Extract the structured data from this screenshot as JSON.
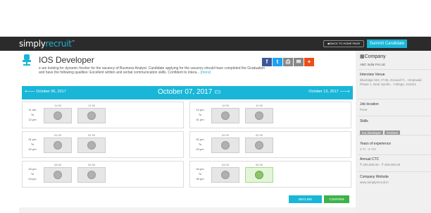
{
  "topbar": {
    "logo_main": "simply",
    "logo_accent": "recruit",
    "logo_tm": "™",
    "back_label": "◀ BACK TO HOME PAGE",
    "user_label": "Summit Candidate"
  },
  "job": {
    "title": "IOS Developer",
    "description": "e are looking for dynamic fresher for the vacancy of Business Analyst. Candidate applying for the vacancy should have completed the Graduation and have the following qualities: Excellent written and verbal communication skills. Confident to intera...",
    "more_label": "[more]",
    "share_icons": [
      "facebook-icon",
      "twitter-icon",
      "print-icon",
      "email-icon",
      "plus-icon"
    ],
    "share_colors": [
      "#3b5998",
      "#1da1f2",
      "#888888",
      "#888888",
      "#e94e1b"
    ]
  },
  "dates": {
    "prev": "October 06, 2017",
    "current": "October 07, 2017",
    "next": "October 13, 2017"
  },
  "schedule": {
    "left": [
      {
        "label": [
          "11 am",
          "To",
          "12 pm"
        ],
        "slots": [
          {
            "time": "11.00",
            "available": false
          },
          {
            "time": "11.30",
            "available": false
          }
        ]
      },
      {
        "label": [
          "01 pm",
          "To",
          "02 pm"
        ],
        "slots": [
          {
            "time": "01.00",
            "available": false
          },
          {
            "time": "01.30",
            "available": false
          }
        ]
      },
      {
        "label": [
          "03 pm",
          "To",
          "04 pm"
        ],
        "slots": [
          {
            "time": "03.00",
            "available": false
          },
          {
            "time": "03.30",
            "available": false
          }
        ]
      }
    ],
    "right": [
      {
        "label": [
          "12 pm",
          "To",
          "01 pm"
        ],
        "slots": [
          {
            "time": "12.00",
            "available": false
          },
          {
            "time": "12.30",
            "available": false
          }
        ]
      },
      {
        "label": [
          "02 pm",
          "To",
          "03 pm"
        ],
        "slots": [
          {
            "time": "02.00",
            "available": false
          },
          {
            "time": "02.30",
            "available": false
          }
        ]
      },
      {
        "label": [
          "04 pm",
          "To",
          "05 pm"
        ],
        "slots": [
          {
            "time": "04.00",
            "available": false
          },
          {
            "time": "04.30",
            "available": true
          }
        ]
      }
    ]
  },
  "actions": {
    "decline": "DECLINE",
    "confirm": "CONFIRM"
  },
  "sidebar": {
    "company_heading": "Company",
    "company_name": "ABC India Pvt Ltd.",
    "venue_heading": "Interview Venue",
    "venue_value": "Blueridge 522, IT-06, Ground Fl... Hinjewadi Phase 1, Near Symbi... College, 411021",
    "location_heading": "Job location",
    "location_value": "Pune",
    "skills_heading": "Skills",
    "skills": [
      "Ios developer",
      "freshers"
    ],
    "experience_heading": "Years of experience",
    "experience_value": "1 Yr - 2 Yrs",
    "ctc_heading": "Annual CTC",
    "ctc_value": "₹ 200,000.00 - ₹ 400,000.00",
    "website_heading": "Company Website",
    "website_value": "www.simplyrecruit.in"
  }
}
